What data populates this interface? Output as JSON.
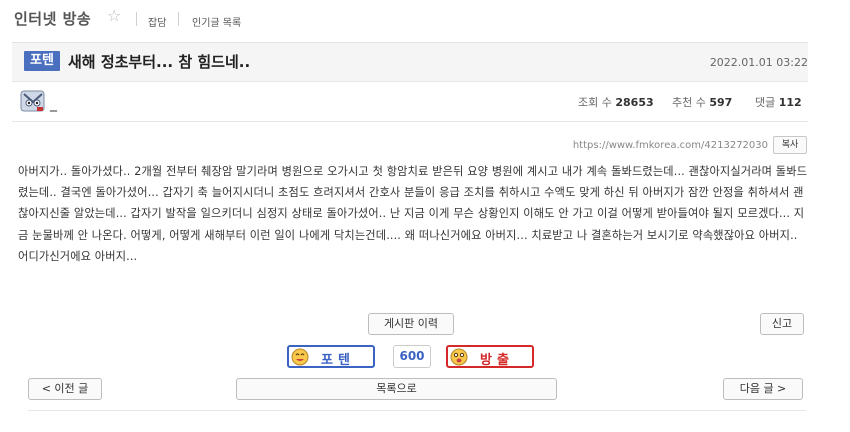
{
  "board": {
    "title": "인터넷 방송",
    "star": "☆",
    "links": [
      "잡담",
      "인기글 목록"
    ]
  },
  "post": {
    "category": "포텐",
    "title": "새해 정초부터... 참 힘드네..",
    "date": "2022.01.01 03:22",
    "author": "_",
    "views_label": "조회 수",
    "views": "28653",
    "likes_label": "추천 수",
    "likes": "597",
    "comments_label": "댓글",
    "comments": "112",
    "url": "https://www.fmkorea.com/4213272030",
    "copy_label": "복사",
    "body": "아버지가.. 돌아가셨다.. 2개월 전부터 췌장암 말기라며 병원으로 오가시고 첫 항암치료 받은뒤 요양 병원에 계시고 내가 계속 돌봐드렸는데... 괜찮아지실거라며 돌봐드렸는데.. 결국엔 돌아가셨어... 갑자기 축 늘어지시더니 초점도 흐려지셔서 간호사 분들이 응급 조치를 취하시고 수액도 맞게 하신 뒤 아버지가 잠깐 안정을 취하셔서 괜찮아지신줄 알았는데... 갑자기 발작을 일으키더니 심정지 상태로 돌아가셨어.. 난 지금 이게 무슨 상황인지 이해도 안 가고 이걸 어떻게 받아들여야 될지 모르겠다... 지금 눈물바께 안 나온다. 어떻게, 어떻게 새해부터 이런 일이 나에게 닥치는건데.... 왜 떠나신거에요 아버지... 치료받고 나 결혼하는거 보시기로 약속했잖아요 아버지.. 어디가신거에요 아버지..."
  },
  "actions": {
    "history": "게시판 이력",
    "report": "신고",
    "vote_up": "포텐",
    "vote_count": "600",
    "vote_down": "방출",
    "prev": "< 이전 글",
    "list": "목록으로",
    "next": "다음 글 >"
  },
  "colors": {
    "badge": "#4a6fbf",
    "vote_up": "#3b63c4",
    "vote_down": "#d52929"
  }
}
